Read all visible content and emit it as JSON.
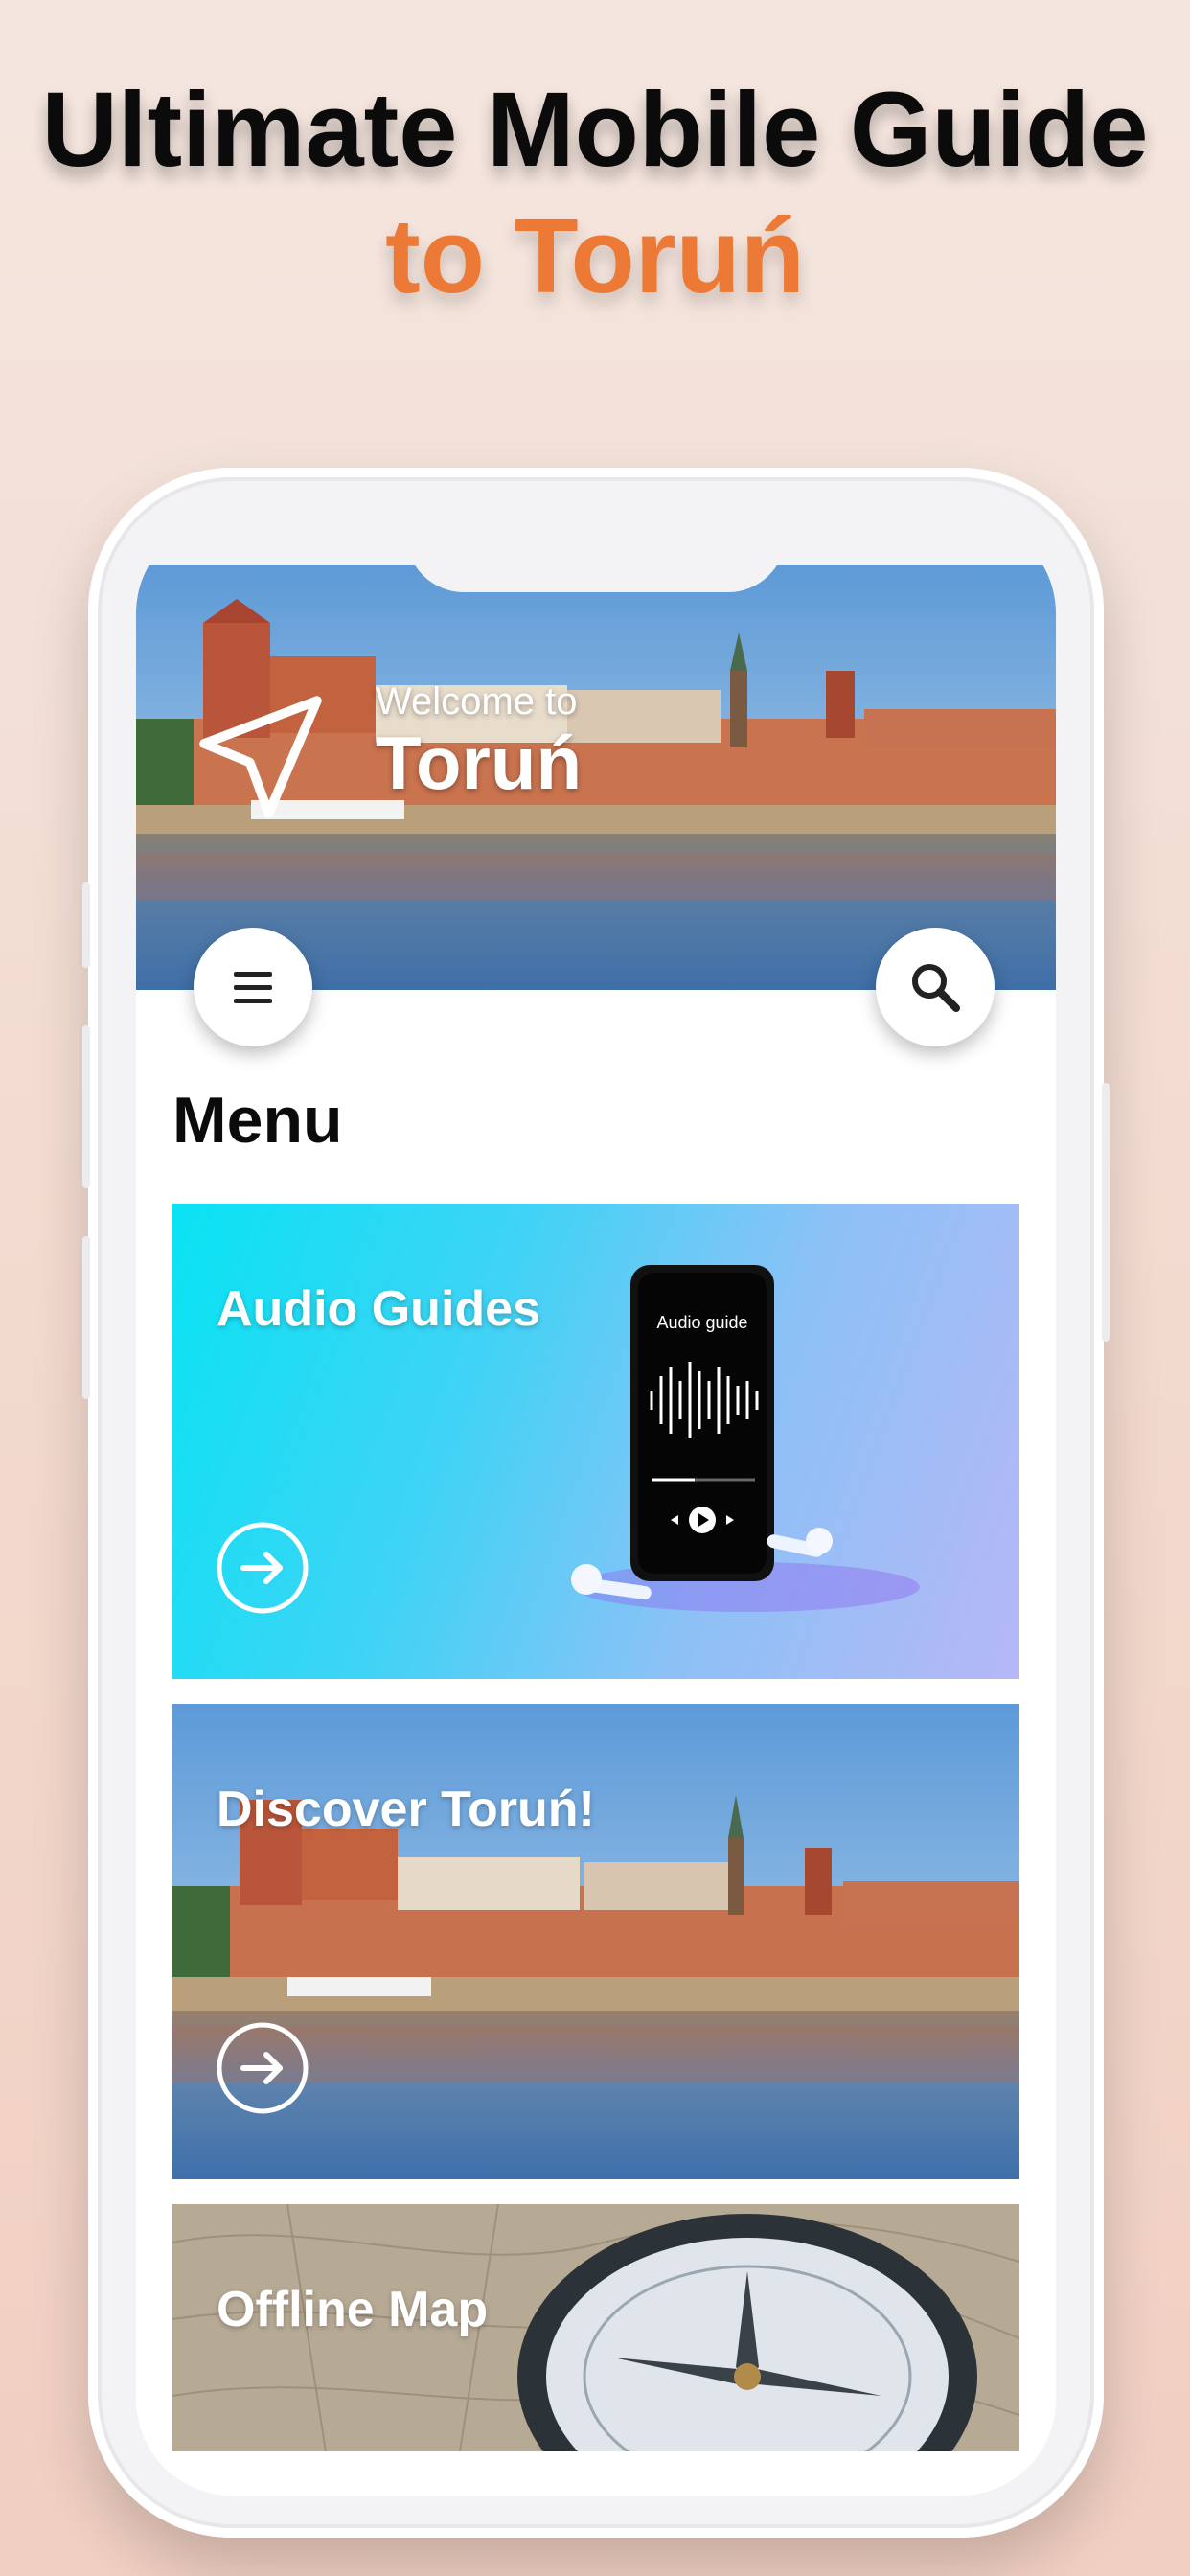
{
  "promo": {
    "headline_line1": "Ultimate Mobile Guide",
    "headline_line2": "to Toruń"
  },
  "colors": {
    "accent": "#ec7a36",
    "background": "#f2dbd0",
    "audio_card_gradient_start": "#09e3f3",
    "audio_card_gradient_end": "#b6b7f6"
  },
  "hero": {
    "welcome": "Welcome to",
    "city": "Toruń",
    "icon": "navigation-arrow-icon"
  },
  "toolbar": {
    "menu_icon": "hamburger-menu-icon",
    "search_icon": "search-icon"
  },
  "menu": {
    "title": "Menu",
    "items": [
      {
        "label": "Audio Guides",
        "icon": "arrow-right-circle-icon"
      },
      {
        "label": "Discover Toruń!",
        "icon": "arrow-right-circle-icon"
      },
      {
        "label": "Offline Map"
      }
    ]
  },
  "audio_phone": {
    "screen_label": "Audio guide"
  }
}
